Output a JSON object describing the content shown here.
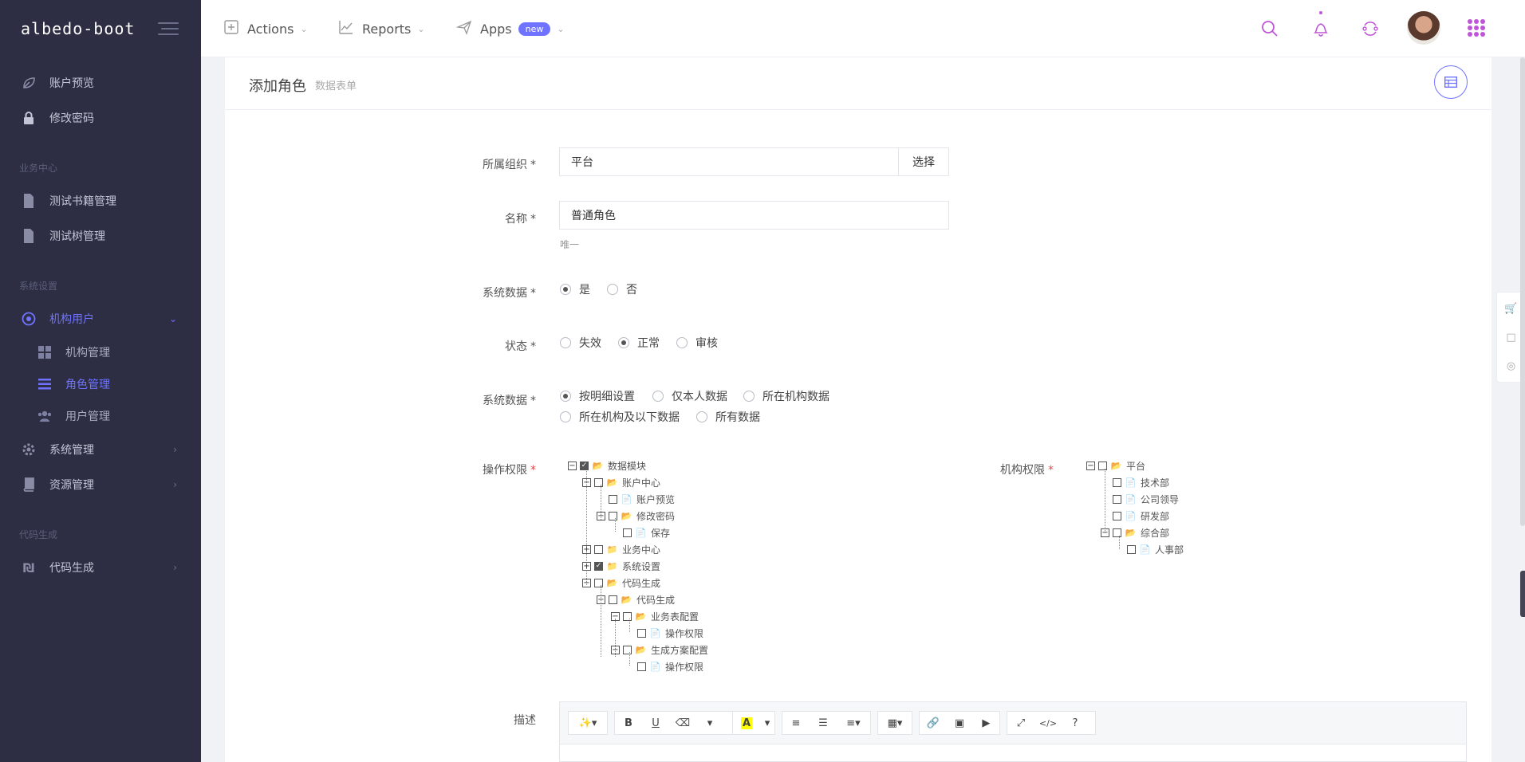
{
  "sidebar": {
    "brand": "albedo-boot",
    "items": [
      {
        "label": "账户预览",
        "icon": "leaf-icon"
      },
      {
        "label": "修改密码",
        "icon": "lock-icon"
      }
    ],
    "section_business": "业务中心",
    "business_items": [
      {
        "label": "测试书籍管理",
        "icon": "file-icon"
      },
      {
        "label": "测试树管理",
        "icon": "file-icon"
      }
    ],
    "section_system": "系统设置",
    "org_users": {
      "label": "机构用户",
      "icon": "target-icon"
    },
    "org_sub": [
      {
        "label": "机构管理",
        "icon": "grid-icon"
      },
      {
        "label": "角色管理",
        "icon": "list-icon"
      },
      {
        "label": "用户管理",
        "icon": "users-icon"
      }
    ],
    "system_manage": {
      "label": "系统管理",
      "icon": "gear-icon"
    },
    "resource_manage": {
      "label": "资源管理",
      "icon": "book-icon"
    },
    "section_codegen": "代码生成",
    "codegen": {
      "label": "代码生成",
      "icon": "code-icon"
    }
  },
  "topbar": {
    "menus": [
      {
        "label": "Actions",
        "icon": "plus-square-icon"
      },
      {
        "label": "Reports",
        "icon": "chart-line-icon"
      },
      {
        "label": "Apps",
        "icon": "paper-plane-icon",
        "badge": "new"
      }
    ],
    "accent": "#c054d6"
  },
  "page": {
    "title": "添加角色",
    "subtitle": "数据表单"
  },
  "form": {
    "org": {
      "label": "所属组织",
      "value": "平台",
      "button": "选择"
    },
    "name": {
      "label": "名称",
      "value": "普通角色",
      "help": "唯一"
    },
    "sysdata": {
      "label": "系统数据",
      "options": [
        "是",
        "否"
      ],
      "selected": "是"
    },
    "status": {
      "label": "状态",
      "options": [
        "失效",
        "正常",
        "审核"
      ],
      "selected": "正常"
    },
    "datascope": {
      "label": "系统数据",
      "options": [
        "按明细设置",
        "仅本人数据",
        "所在机构数据",
        "所在机构及以下数据",
        "所有数据"
      ],
      "selected": "按明细设置"
    },
    "perm": {
      "label": "操作权限",
      "tree": [
        {
          "label": "数据模块",
          "checked": true
        },
        {
          "label": "账户中心",
          "checked": false
        },
        {
          "label": "账户预览",
          "checked": false
        },
        {
          "label": "修改密码",
          "checked": false
        },
        {
          "label": "保存",
          "checked": false
        },
        {
          "label": "业务中心",
          "checked": false
        },
        {
          "label": "系统设置",
          "checked": true
        },
        {
          "label": "代码生成",
          "checked": false
        },
        {
          "label": "代码生成",
          "checked": false
        },
        {
          "label": "业务表配置",
          "checked": false
        },
        {
          "label": "操作权限",
          "checked": false
        },
        {
          "label": "生成方案配置",
          "checked": false
        },
        {
          "label": "操作权限",
          "checked": false
        }
      ]
    },
    "orgperm": {
      "label": "机构权限",
      "tree": [
        {
          "label": "平台"
        },
        {
          "label": "技术部"
        },
        {
          "label": "公司领导"
        },
        {
          "label": "研发部"
        },
        {
          "label": "综合部"
        },
        {
          "label": "人事部"
        }
      ]
    },
    "desc": {
      "label": "描述"
    }
  },
  "editor": {
    "buttons": [
      "magic-icon",
      "bold-icon",
      "underline-icon",
      "eraser-icon",
      "font-dropdown",
      "highlight-icon",
      "bullet-list-icon",
      "ordered-list-icon",
      "align-icon",
      "table-icon",
      "link-icon",
      "image-icon",
      "video-icon",
      "fullscreen-icon",
      "code-icon",
      "help-icon"
    ],
    "bold": "B",
    "underline": "U",
    "highlight": "A",
    "code": "</>",
    "help": "?"
  }
}
